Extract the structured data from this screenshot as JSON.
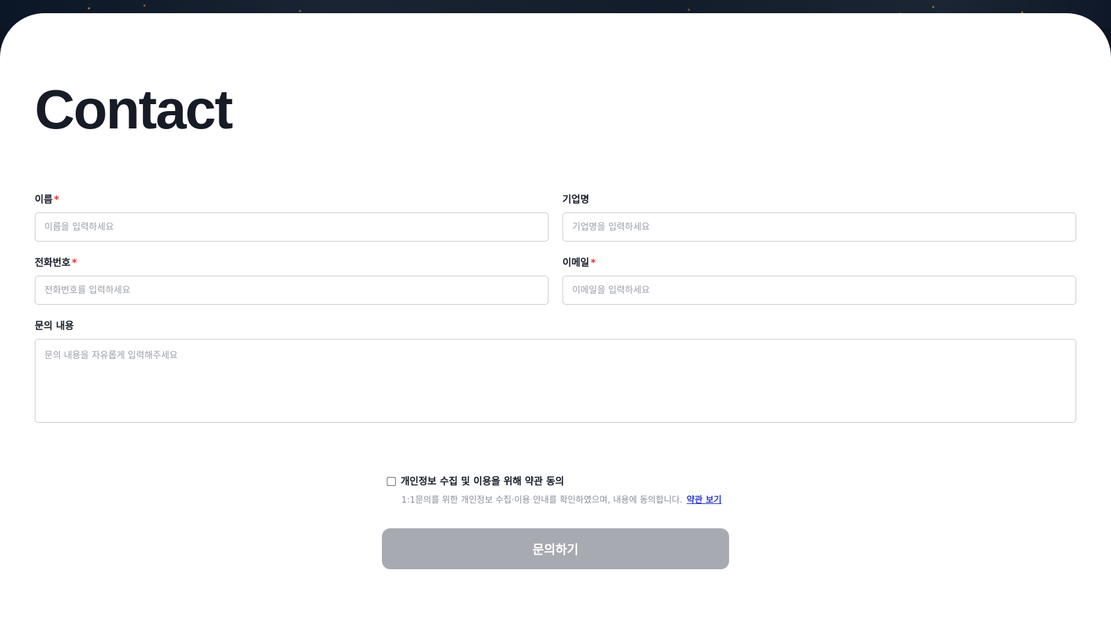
{
  "page": {
    "title": "Contact"
  },
  "form": {
    "name": {
      "label": "이름",
      "required_mark": "*",
      "placeholder": "이름을 입력하세요",
      "value": ""
    },
    "company": {
      "label": "기업명",
      "placeholder": "기업명을 입력하세요",
      "value": ""
    },
    "phone": {
      "label": "전화번호",
      "required_mark": "*",
      "placeholder": "전화번호를 입력하세요",
      "value": ""
    },
    "email": {
      "label": "이메일",
      "required_mark": "*",
      "placeholder": "이메일을 입력하세요",
      "value": ""
    },
    "message": {
      "label": "문의 내용",
      "placeholder": "문의 내용을 자유롭게 입력해주세요",
      "value": ""
    }
  },
  "consent": {
    "label": "개인정보 수집 및 이용을 위해 약관 동의",
    "description": "1:1문의를 위한 개인정보 수집·이용 안내를 확인하였으며, 내용에 동의합니다.",
    "link_label": "약관 보기",
    "checked": false
  },
  "submit": {
    "label": "문의하기"
  },
  "colors": {
    "required": "#e5342f",
    "link": "#2f3ec2",
    "button_disabled": "#a7aab1",
    "title": "#161b26"
  }
}
